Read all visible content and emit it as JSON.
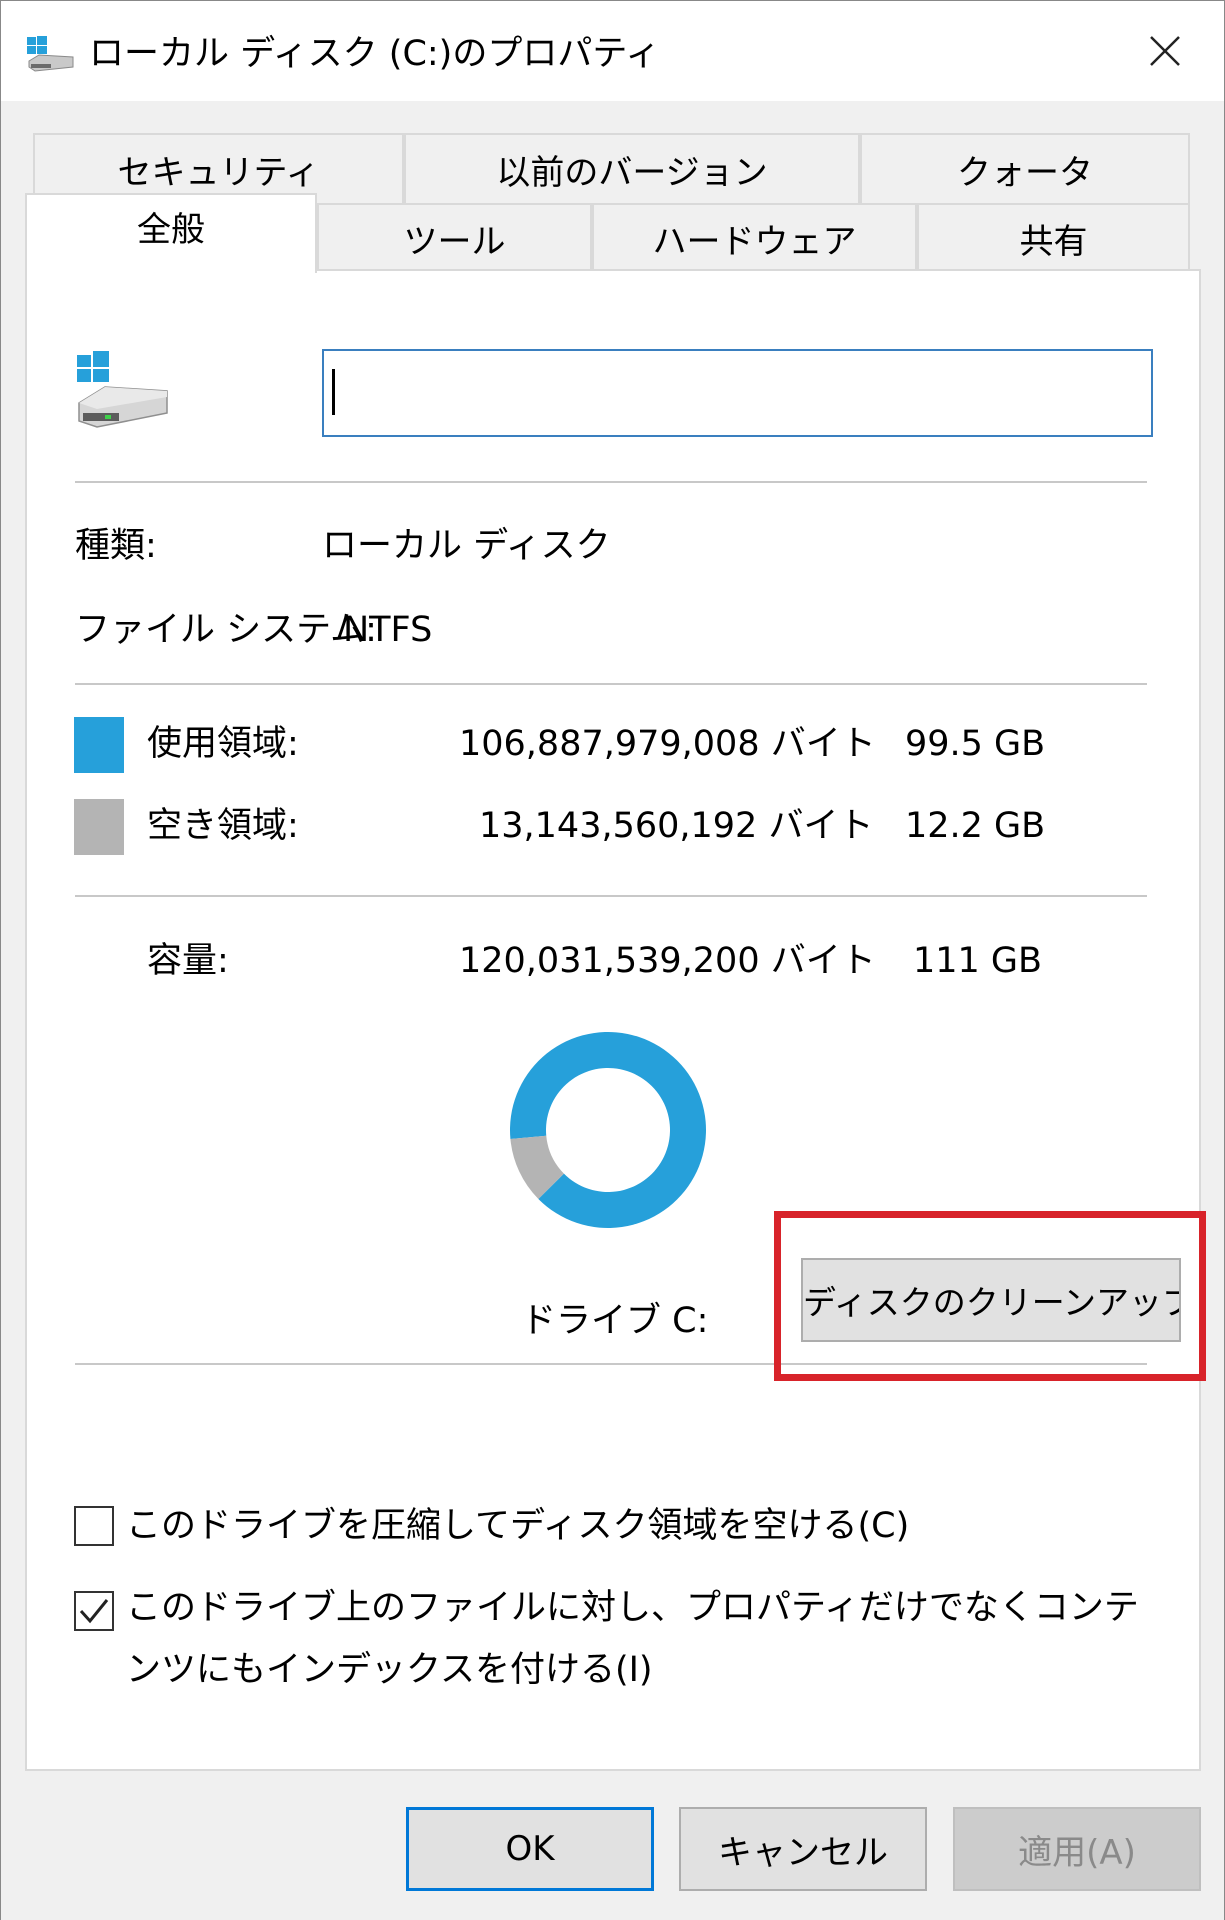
{
  "window": {
    "title": "ローカル ディスク (C:)のプロパティ"
  },
  "tabs": {
    "row_back": [
      {
        "label": "セキュリティ"
      },
      {
        "label": "以前のバージョン"
      },
      {
        "label": "クォータ"
      }
    ],
    "row_front": [
      {
        "label": "全般",
        "active": true
      },
      {
        "label": "ツール"
      },
      {
        "label": "ハードウェア"
      },
      {
        "label": "共有"
      }
    ]
  },
  "general": {
    "name_value": "",
    "type_label": "種類:",
    "type_value": "ローカル ディスク",
    "fs_label": "ファイル システム:",
    "fs_value": "NTFS",
    "used": {
      "label": "使用領域:",
      "bytes": "106,887,979,008 バイト",
      "size": "99.5 GB",
      "color": "#26a0da"
    },
    "free": {
      "label": "空き領域:",
      "bytes": "13,143,560,192 バイト",
      "size": "12.2 GB",
      "color": "#b4b4b4"
    },
    "capacity": {
      "label": "容量:",
      "bytes": "120,031,539,200 バイト",
      "size": "111 GB"
    },
    "drive_label": "ドライブ C:",
    "cleanup_button": "ディスクのクリーンアップ(D)",
    "used_fraction": 0.8905
  },
  "options": {
    "compress": {
      "label": "このドライブを圧縮してディスク領域を空ける(C)",
      "checked": false
    },
    "index": {
      "label": "このドライブ上のファイルに対し、プロパティだけでなくコンテンツにもインデックスを付ける(I)",
      "checked": true
    }
  },
  "footer": {
    "ok": "OK",
    "cancel": "キャンセル",
    "apply": "適用(A)"
  },
  "colors": {
    "highlight": "#d8232a",
    "accent": "#0078d7"
  }
}
